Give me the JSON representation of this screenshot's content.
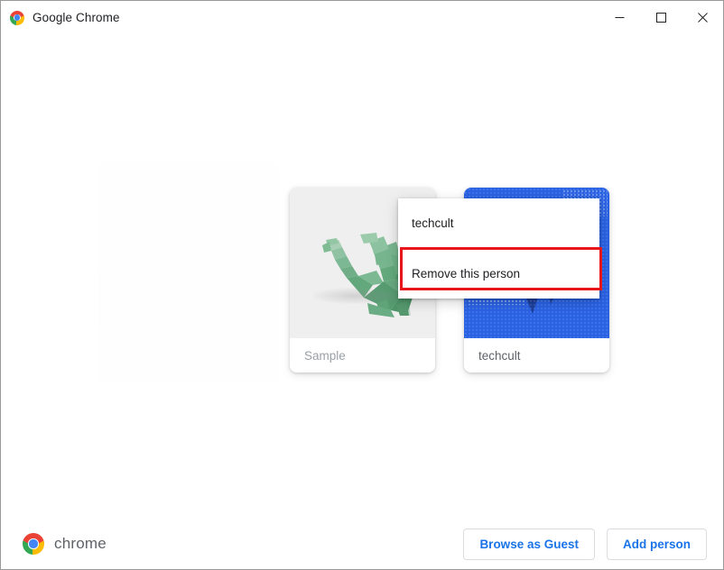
{
  "window": {
    "title": "Google Chrome",
    "logo_icon": "chrome-logo-icon",
    "controls": {
      "minimize_label": "Minimize",
      "maximize_label": "Maximize",
      "close_label": "Close"
    }
  },
  "profiles": [
    {
      "name": "Sample",
      "avatar_icon": "origami-dragon-avatar",
      "avatar_background": "#efefef",
      "name_color": "#9aa0a6"
    },
    {
      "name": "techcult",
      "avatar_icon": "blue-abstract-avatar",
      "avatar_background": "#2A62E4",
      "name_color": "#5f6368"
    }
  ],
  "context_menu": {
    "header": "techcult",
    "remove_label": "Remove this person"
  },
  "annotation": {
    "color": "#E8151B",
    "target": "Remove this person"
  },
  "footer": {
    "brand_logo_icon": "chrome-logo-icon",
    "wordmark": "chrome",
    "browse_guest_label": "Browse as Guest",
    "add_person_label": "Add person",
    "accent_color": "#1a73e8"
  }
}
